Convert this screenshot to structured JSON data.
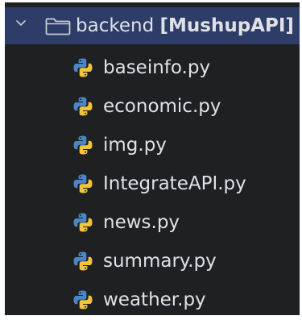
{
  "tree": {
    "folder": {
      "name": "backend",
      "module": "[MushupAPI]",
      "expanded": true,
      "icon": "folder-icon",
      "toggle_icon": "chevron-down-icon"
    },
    "files": [
      {
        "name": "baseinfo.py",
        "icon": "python-file-icon"
      },
      {
        "name": "economic.py",
        "icon": "python-file-icon"
      },
      {
        "name": "img.py",
        "icon": "python-file-icon"
      },
      {
        "name": "IntegrateAPI.py",
        "icon": "python-file-icon"
      },
      {
        "name": "news.py",
        "icon": "python-file-icon"
      },
      {
        "name": "summary.py",
        "icon": "python-file-icon"
      },
      {
        "name": "weather.py",
        "icon": "python-file-icon"
      }
    ]
  },
  "colors": {
    "background": "#1f2022",
    "selection": "#2d3d68",
    "text": "#dfe1e5",
    "python_blue": "#4a86c7",
    "python_yellow": "#f2c43b"
  }
}
